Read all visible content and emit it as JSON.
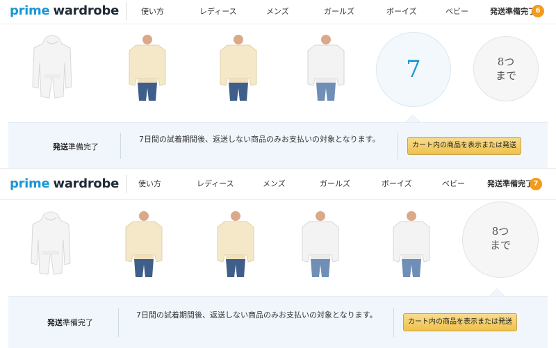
{
  "screens": [
    {
      "logo": {
        "prime": "prime",
        "wardrobe": "wardrobe"
      },
      "nav": [
        "使い方",
        "レディース",
        "メンズ",
        "ガールズ",
        "ボーイズ",
        "ベビー"
      ],
      "ready_label": "発送準備完了",
      "badge_count": "6",
      "circle_count": "7",
      "limit": {
        "line1": "8つ",
        "line2": "まで"
      },
      "bar": {
        "label_bold": "発送",
        "label_rest": "準備完了",
        "message": "7日間の試着期間後、返送しない商品のみお支払いの対象となります。",
        "button": "カート内の商品を表示または発送"
      }
    },
    {
      "logo": {
        "prime": "prime",
        "wardrobe": "wardrobe"
      },
      "nav": [
        "使い方",
        "レディース",
        "メンズ",
        "ガールズ",
        "ボーイズ",
        "ベビー"
      ],
      "ready_label": "発送準備完了",
      "badge_count": "7",
      "limit": {
        "line1": "8つ",
        "line2": "まで"
      },
      "bar": {
        "label_bold": "発送",
        "label_rest": "準備完了",
        "message": "7日間の試着期間後、返送しない商品のみお支払いの対象となります。",
        "button": "カート内の商品を表示または発送"
      }
    }
  ],
  "colors": {
    "accent": "#1a98d5",
    "badge": "#f29b1d",
    "button": "#f0c14b",
    "bar_bg": "#f0f6fb"
  },
  "items": [
    {
      "icon": "white-hoodie-image"
    },
    {
      "icon": "cream-hoodie-image"
    },
    {
      "icon": "cream-hoodie-image"
    },
    {
      "icon": "white-hoodie-image"
    }
  ]
}
